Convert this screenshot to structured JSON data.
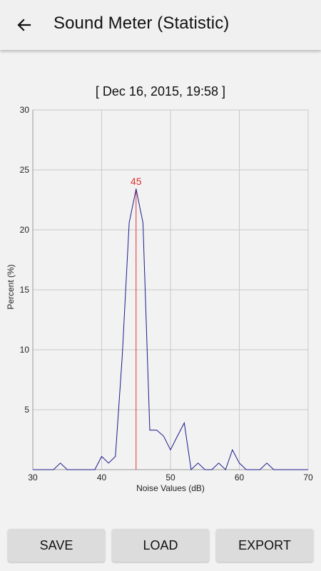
{
  "appbar": {
    "back_icon": "arrow-left-icon",
    "title": "Sound Meter (Statistic)"
  },
  "timestamp": "[ Dec 16, 2015, 19:58 ]",
  "buttons": {
    "save": "SAVE",
    "load": "LOAD",
    "export": "EXPORT"
  },
  "colors": {
    "series": "#1a1a8c",
    "marker": "#e03030",
    "grid": "#c8c8c8"
  },
  "chart_data": {
    "type": "line",
    "xlabel": "Noise Values (dB)",
    "ylabel": "Percent (%)",
    "xlim": [
      30,
      70
    ],
    "ylim": [
      0,
      30
    ],
    "xticks": [
      30,
      40,
      50,
      60,
      70
    ],
    "yticks": [
      5,
      10,
      15,
      20,
      25,
      30
    ],
    "grid": true,
    "peak": {
      "x": 45,
      "label": "45"
    },
    "series": [
      {
        "x": [
          30,
          31,
          32,
          33,
          34,
          35,
          36,
          37,
          38,
          39,
          40,
          41,
          42,
          43,
          44,
          45,
          46,
          47,
          48,
          49,
          50,
          51,
          52,
          53,
          54,
          55,
          56,
          57,
          58,
          59,
          60,
          61,
          62,
          63,
          64,
          65,
          66,
          67,
          68,
          69,
          70
        ],
        "values": [
          0,
          0,
          0,
          0,
          0.55,
          0,
          0,
          0,
          0,
          0,
          1.1,
          0.55,
          1.1,
          9.5,
          20.6,
          23.4,
          20.6,
          3.3,
          3.3,
          2.8,
          1.65,
          2.8,
          3.9,
          0,
          0.55,
          0,
          0,
          0.55,
          0,
          1.65,
          0.55,
          0,
          0,
          0,
          0.55,
          0,
          0,
          0,
          0,
          0,
          0
        ]
      }
    ]
  }
}
